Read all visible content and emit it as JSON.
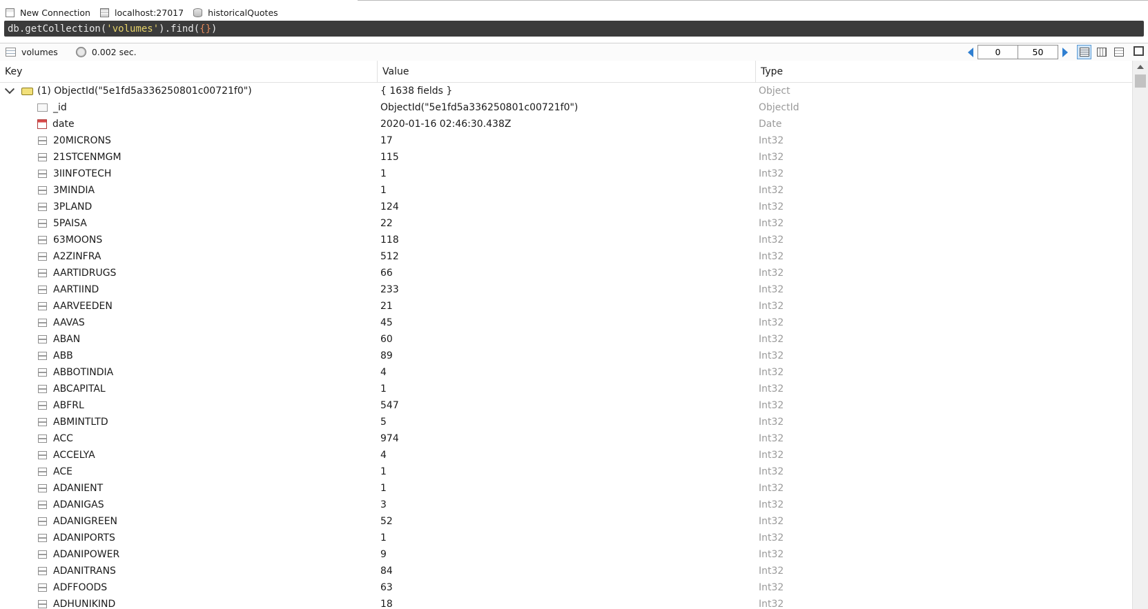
{
  "connection": {
    "new_connection": "New Connection",
    "server": "localhost:27017",
    "database": "historicalQuotes"
  },
  "query": {
    "prefix": "db.getCollection(",
    "collection": "'volumes'",
    "mid": ").find(",
    "arg": "{}",
    "suffix": ")"
  },
  "results_toolbar": {
    "collection": "volumes",
    "elapsed": "0.002 sec.",
    "page_start": "0",
    "page_size": "50"
  },
  "grid": {
    "headers": {
      "key": "Key",
      "value": "Value",
      "type": "Type"
    },
    "root": {
      "key": "(1) ObjectId(\"5e1fd5a336250801c00721f0\")",
      "value": "{ 1638 fields }",
      "type": "Object"
    },
    "rows": [
      {
        "key": "_id",
        "value": "ObjectId(\"5e1fd5a336250801c00721f0\")",
        "type": "ObjectId",
        "icon": "id-icon"
      },
      {
        "key": "date",
        "value": "2020-01-16 02:46:30.438Z",
        "type": "Date",
        "icon": "date-icon"
      },
      {
        "key": "20MICRONS",
        "value": "17",
        "type": "Int32",
        "icon": "int-field-icon"
      },
      {
        "key": "21STCENMGM",
        "value": "115",
        "type": "Int32",
        "icon": "int-field-icon"
      },
      {
        "key": "3IINFOTECH",
        "value": "1",
        "type": "Int32",
        "icon": "int-field-icon"
      },
      {
        "key": "3MINDIA",
        "value": "1",
        "type": "Int32",
        "icon": "int-field-icon"
      },
      {
        "key": "3PLAND",
        "value": "124",
        "type": "Int32",
        "icon": "int-field-icon"
      },
      {
        "key": "5PAISA",
        "value": "22",
        "type": "Int32",
        "icon": "int-field-icon"
      },
      {
        "key": "63MOONS",
        "value": "118",
        "type": "Int32",
        "icon": "int-field-icon"
      },
      {
        "key": "A2ZINFRA",
        "value": "512",
        "type": "Int32",
        "icon": "int-field-icon"
      },
      {
        "key": "AARTIDRUGS",
        "value": "66",
        "type": "Int32",
        "icon": "int-field-icon"
      },
      {
        "key": "AARTIIND",
        "value": "233",
        "type": "Int32",
        "icon": "int-field-icon"
      },
      {
        "key": "AARVEEDEN",
        "value": "21",
        "type": "Int32",
        "icon": "int-field-icon"
      },
      {
        "key": "AAVAS",
        "value": "45",
        "type": "Int32",
        "icon": "int-field-icon"
      },
      {
        "key": "ABAN",
        "value": "60",
        "type": "Int32",
        "icon": "int-field-icon"
      },
      {
        "key": "ABB",
        "value": "89",
        "type": "Int32",
        "icon": "int-field-icon"
      },
      {
        "key": "ABBOTINDIA",
        "value": "4",
        "type": "Int32",
        "icon": "int-field-icon"
      },
      {
        "key": "ABCAPITAL",
        "value": "1",
        "type": "Int32",
        "icon": "int-field-icon"
      },
      {
        "key": "ABFRL",
        "value": "547",
        "type": "Int32",
        "icon": "int-field-icon"
      },
      {
        "key": "ABMINTLTD",
        "value": "5",
        "type": "Int32",
        "icon": "int-field-icon"
      },
      {
        "key": "ACC",
        "value": "974",
        "type": "Int32",
        "icon": "int-field-icon"
      },
      {
        "key": "ACCELYA",
        "value": "4",
        "type": "Int32",
        "icon": "int-field-icon"
      },
      {
        "key": "ACE",
        "value": "1",
        "type": "Int32",
        "icon": "int-field-icon"
      },
      {
        "key": "ADANIENT",
        "value": "1",
        "type": "Int32",
        "icon": "int-field-icon"
      },
      {
        "key": "ADANIGAS",
        "value": "3",
        "type": "Int32",
        "icon": "int-field-icon"
      },
      {
        "key": "ADANIGREEN",
        "value": "52",
        "type": "Int32",
        "icon": "int-field-icon"
      },
      {
        "key": "ADANIPORTS",
        "value": "1",
        "type": "Int32",
        "icon": "int-field-icon"
      },
      {
        "key": "ADANIPOWER",
        "value": "9",
        "type": "Int32",
        "icon": "int-field-icon"
      },
      {
        "key": "ADANITRANS",
        "value": "84",
        "type": "Int32",
        "icon": "int-field-icon"
      },
      {
        "key": "ADFFOODS",
        "value": "63",
        "type": "Int32",
        "icon": "int-field-icon"
      },
      {
        "key": "ADHUNIKIND",
        "value": "18",
        "type": "Int32",
        "icon": "int-field-icon"
      }
    ]
  },
  "colors": {
    "query_bg": "#3b3b3b",
    "query_string": "#e6d36a",
    "type_text": "#9a9a9a",
    "accent": "#2f7fd1"
  }
}
